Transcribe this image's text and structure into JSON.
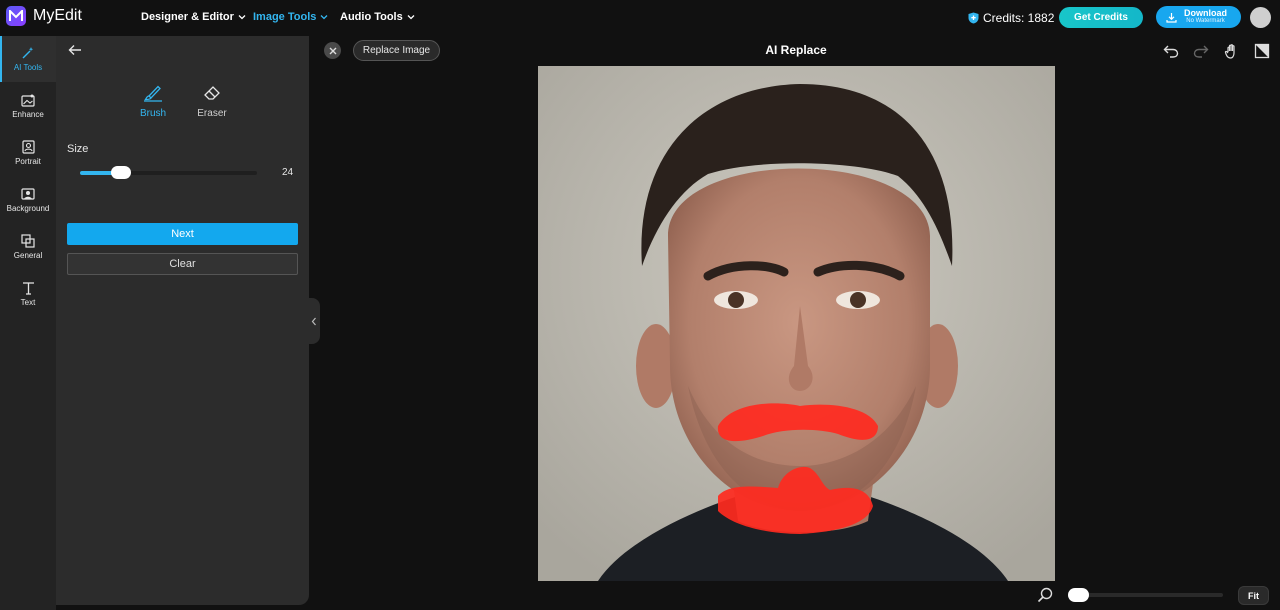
{
  "app": {
    "name": "MyEdit"
  },
  "nav": {
    "designer": "Designer & Editor",
    "image_tools": "Image Tools",
    "audio_tools": "Audio Tools"
  },
  "header": {
    "credits": "Credits: 1882",
    "get_credits": "Get Credits",
    "download": "Download",
    "download_sub": "No Watermark"
  },
  "rail": {
    "items": [
      {
        "label": "AI Tools",
        "icon": "magic-wand-icon",
        "active": true
      },
      {
        "label": "Enhance",
        "icon": "enhance-icon"
      },
      {
        "label": "Portrait",
        "icon": "portrait-icon"
      },
      {
        "label": "Background",
        "icon": "background-icon"
      },
      {
        "label": "General",
        "icon": "general-icon"
      },
      {
        "label": "Text",
        "icon": "text-icon"
      }
    ]
  },
  "panel": {
    "brush": "Brush",
    "eraser": "Eraser",
    "size_label": "Size",
    "size_value": "24",
    "size_fraction": 0.23,
    "next": "Next",
    "clear": "Clear"
  },
  "canvas": {
    "replace_image": "Replace Image",
    "title": "AI Replace",
    "fit": "Fit",
    "zoom_fraction": 0.0
  },
  "colors": {
    "accent": "#33b6f0",
    "mask": "#ff2a20"
  }
}
